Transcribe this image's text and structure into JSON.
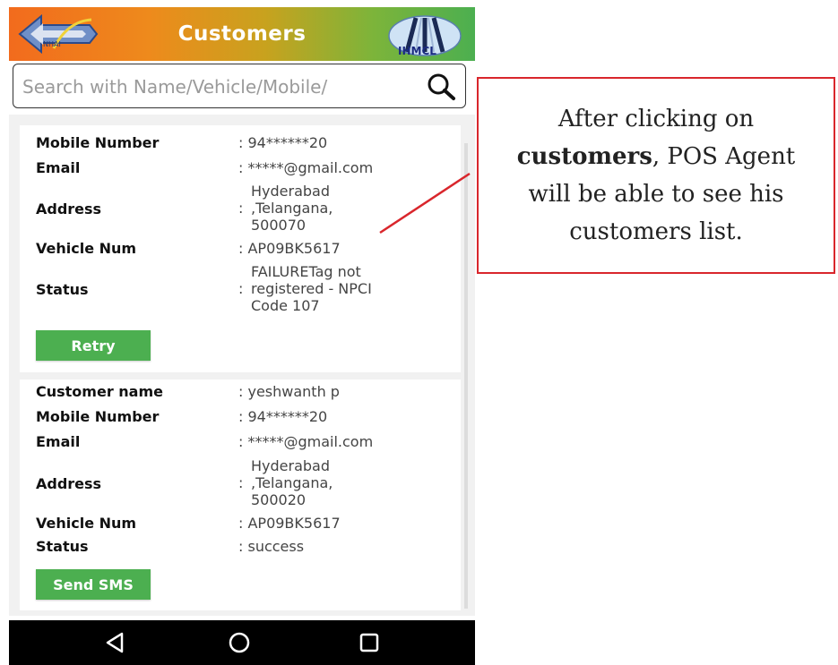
{
  "header": {
    "title": "Customers",
    "logo_text": "IHMCL",
    "back_logo_text": "NHAI"
  },
  "search": {
    "placeholder": "Search with Name/Vehicle/Mobile/",
    "icon": "search-icon"
  },
  "customers": [
    {
      "rows": [
        {
          "label": "Mobile Number",
          "value": ": 94******20"
        },
        {
          "label": "Email",
          "value": ": *****@gmail.com"
        },
        {
          "label": "Address",
          "value_lines": [
            "Hyderabad",
            ",Telangana,",
            "500070"
          ]
        },
        {
          "label": "Vehicle Num",
          "value": ": AP09BK5617"
        },
        {
          "label": "Status",
          "value_lines": [
            "FAILURETag not",
            "registered - NPCI",
            "Code 107"
          ]
        }
      ],
      "action": "Retry"
    },
    {
      "rows": [
        {
          "label": "Customer name",
          "value": ": yeshwanth p"
        },
        {
          "label": "Mobile Number",
          "value": ": 94******20"
        },
        {
          "label": "Email",
          "value": ": *****@gmail.com"
        },
        {
          "label": "Address",
          "value_lines": [
            "Hyderabad",
            ",Telangana,",
            "500020"
          ]
        },
        {
          "label": "Vehicle Num",
          "value": ": AP09BK5617"
        },
        {
          "label": "Status",
          "value": ": success"
        }
      ],
      "action": "Send SMS"
    }
  ],
  "navbar": {
    "icons": [
      "back-triangle-icon",
      "home-circle-icon",
      "recents-square-icon"
    ]
  },
  "annotation": {
    "line1": "After clicking on",
    "line2_bold": "customers",
    "line2_rest": ", POS Agent",
    "line3": "will be able to see his",
    "line4": "customers list."
  },
  "colors": {
    "accent_green": "#4caf50",
    "header_orange": "#f26b1d",
    "callout_border": "#d9262c"
  }
}
